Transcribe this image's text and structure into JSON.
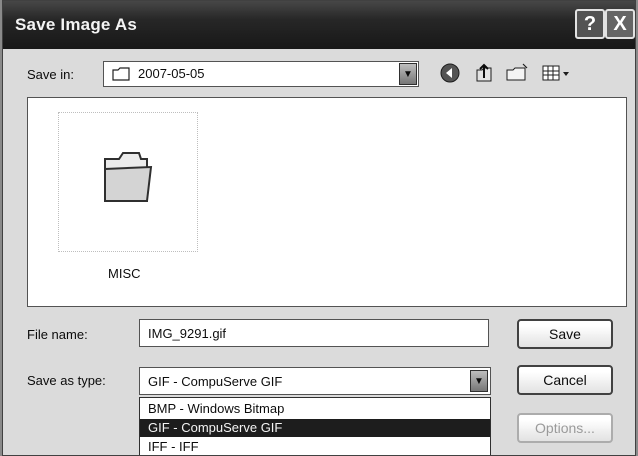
{
  "window": {
    "title": "Save Image As"
  },
  "title_buttons": {
    "help": "?",
    "close": "X"
  },
  "save_in": {
    "label": "Save in:",
    "value": "2007-05-05"
  },
  "toolbar": {
    "back_icon": "back-icon",
    "up_icon": "up-folder-icon",
    "new_folder_icon": "new-folder-icon",
    "views_icon": "views-menu-icon"
  },
  "files": [
    {
      "name": "MISC",
      "icon": "folder-icon"
    }
  ],
  "file_name": {
    "label": "File name:",
    "value": "IMG_9291.gif"
  },
  "save_as_type": {
    "label": "Save as type:",
    "value": "GIF - CompuServe GIF",
    "options": [
      "BMP - Windows Bitmap",
      "GIF - CompuServe GIF",
      "IFF - IFF"
    ],
    "selected_index": 1
  },
  "buttons": {
    "save": "Save",
    "cancel": "Cancel",
    "options": "Options..."
  }
}
